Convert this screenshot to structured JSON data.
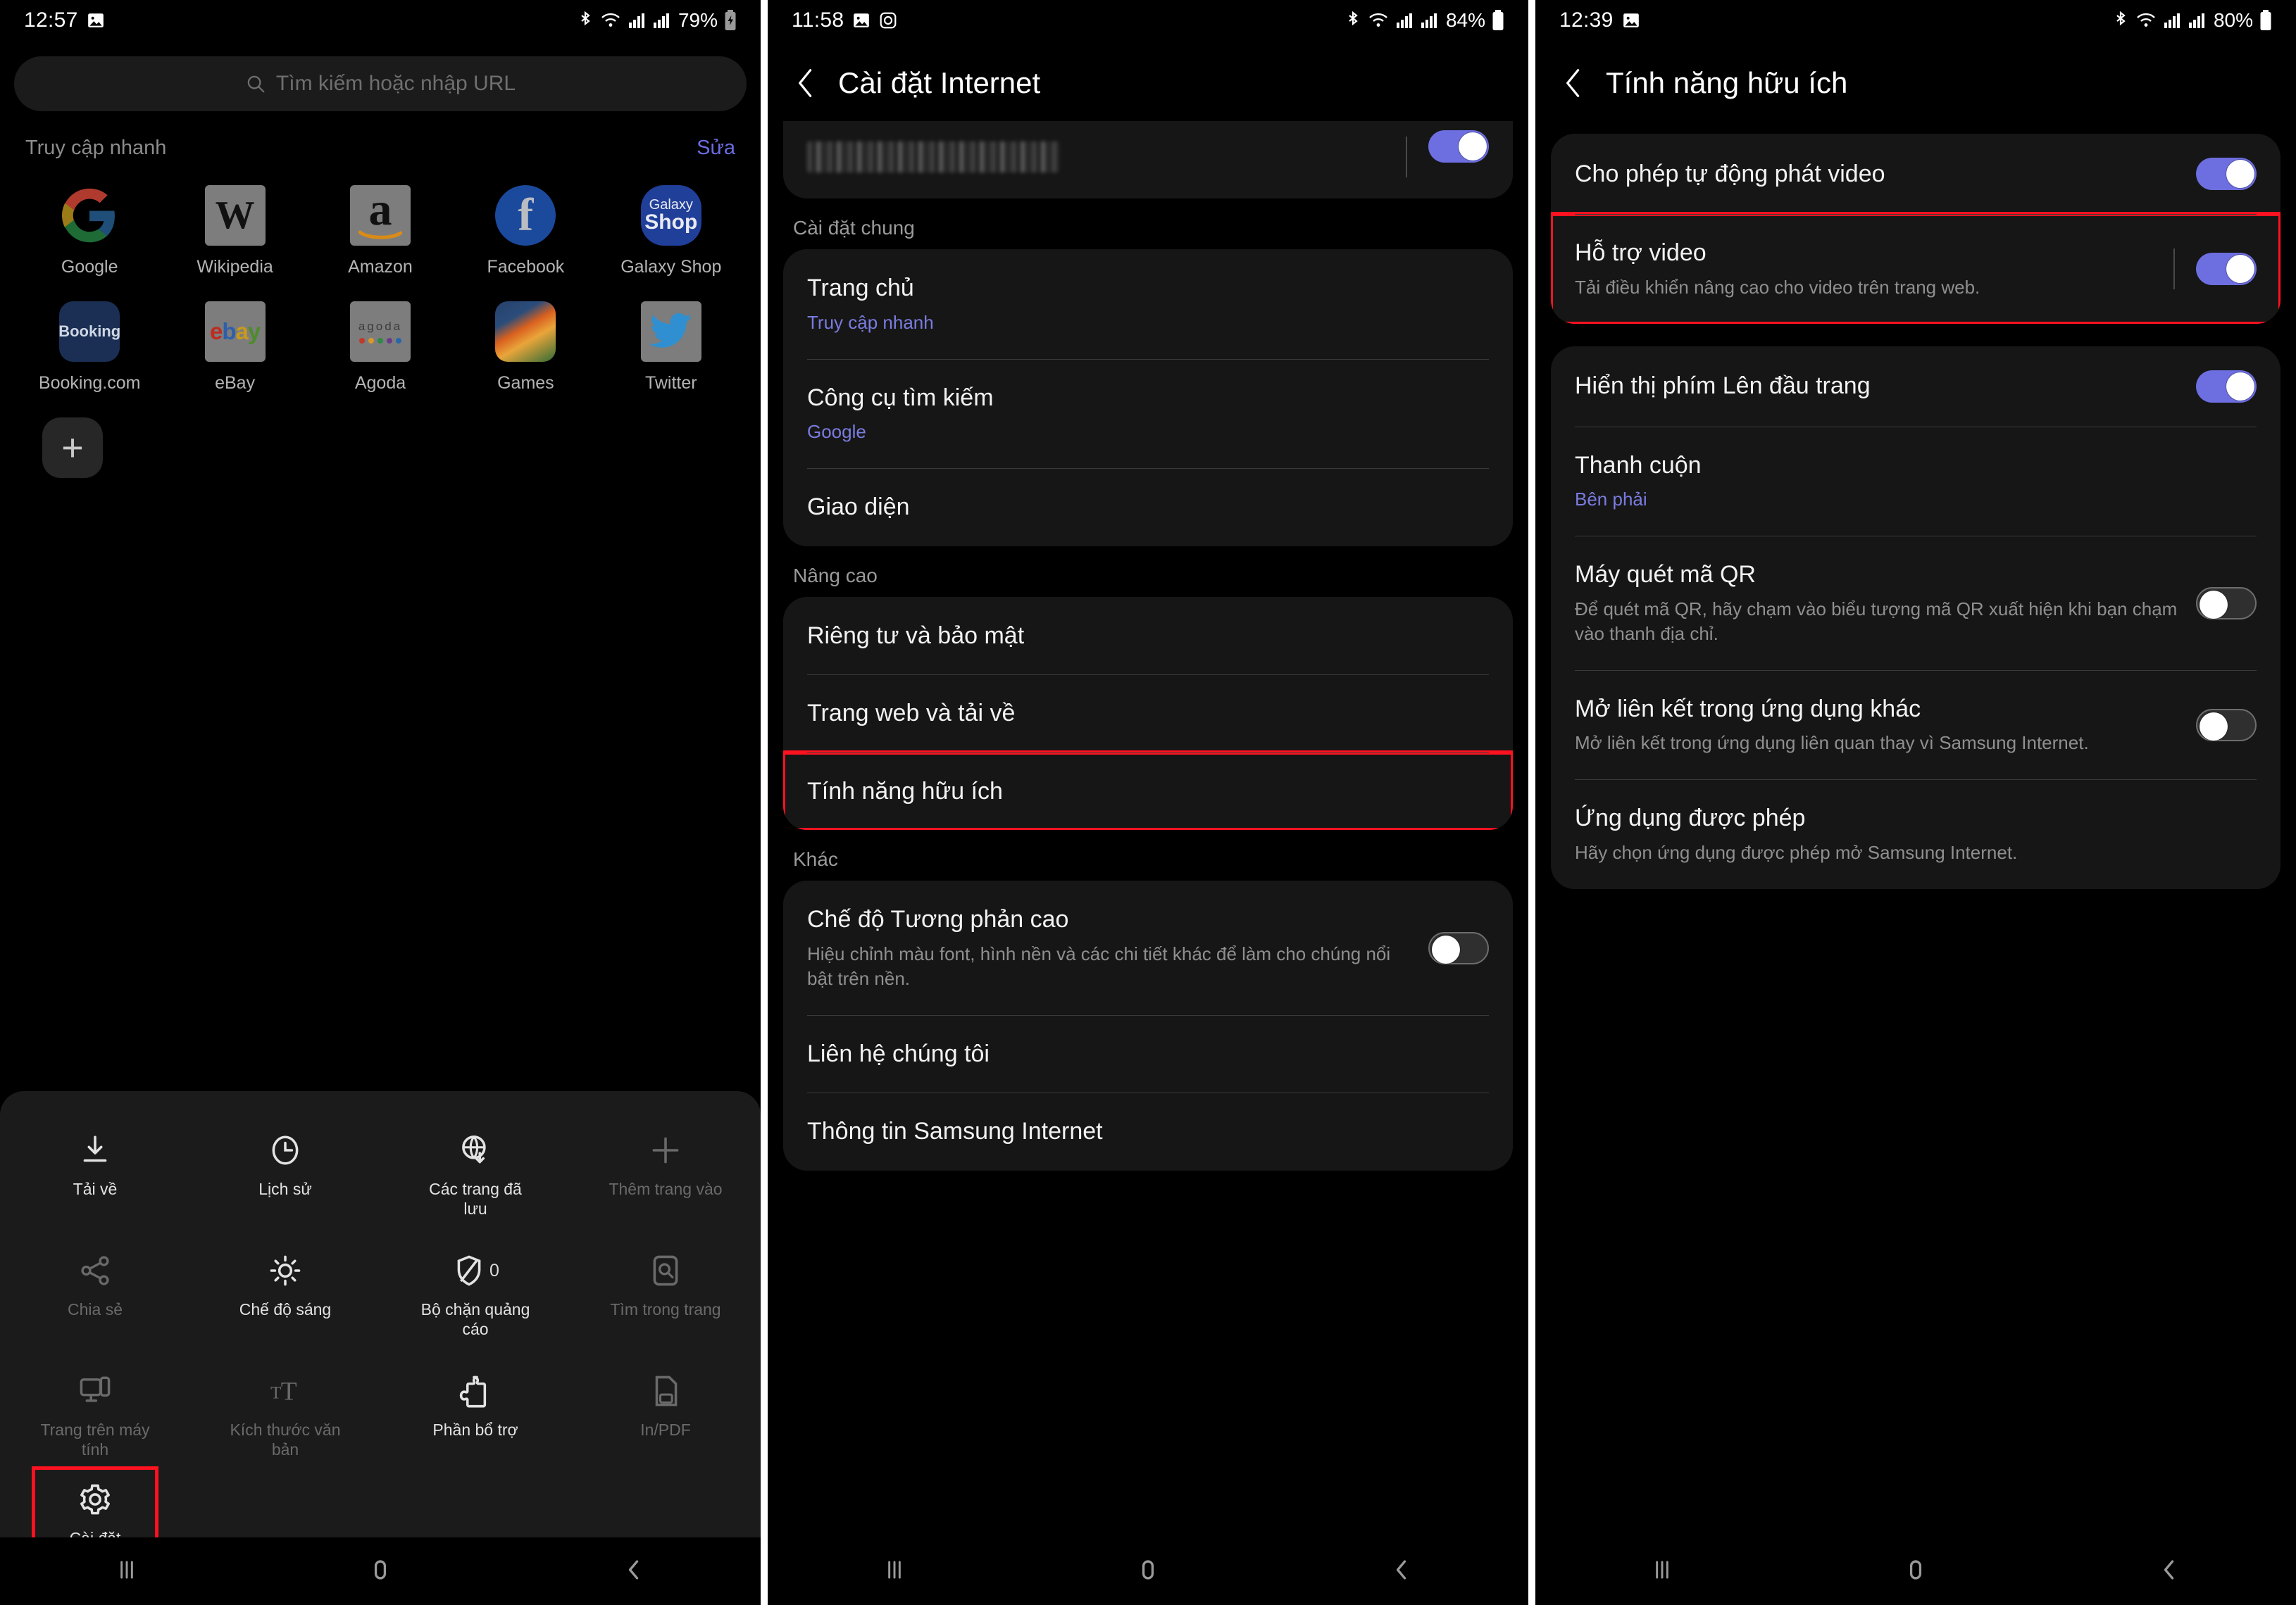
{
  "panel1": {
    "status": {
      "time": "12:57",
      "battery": "79%",
      "icons": [
        "image-icon",
        "bluetooth-icon",
        "wifi-icon",
        "signal-icon",
        "signal2-icon",
        "battery-charging-icon"
      ]
    },
    "urlbar": {
      "placeholder": "Tìm kiếm hoặc nhập URL",
      "icon": "search-icon"
    },
    "quick_access": {
      "title": "Truy cập nhanh",
      "edit_label": "Sửa",
      "items": [
        {
          "label": "Google",
          "icon": "google-icon"
        },
        {
          "label": "Wikipedia",
          "icon": "wikipedia-icon"
        },
        {
          "label": "Amazon",
          "icon": "amazon-icon"
        },
        {
          "label": "Facebook",
          "icon": "facebook-icon"
        },
        {
          "label": "Galaxy Shop",
          "icon": "galaxy-shop-icon"
        },
        {
          "label": "Booking.com",
          "icon": "booking-icon"
        },
        {
          "label": "eBay",
          "icon": "ebay-icon"
        },
        {
          "label": "Agoda",
          "icon": "agoda-icon"
        },
        {
          "label": "Games",
          "icon": "games-icon"
        },
        {
          "label": "Twitter",
          "icon": "twitter-icon"
        }
      ],
      "add_label": "+"
    },
    "menu": {
      "items": [
        {
          "label": "Tải về",
          "icon": "download-icon",
          "enabled": true
        },
        {
          "label": "Lịch sử",
          "icon": "history-clock-icon",
          "enabled": true
        },
        {
          "label": "Các trang đã lưu",
          "icon": "saved-pages-globe-icon",
          "enabled": true
        },
        {
          "label": "Thêm trang vào",
          "icon": "plus-icon",
          "enabled": false
        },
        {
          "label": "Chia sẻ",
          "icon": "share-icon",
          "enabled": false
        },
        {
          "label": "Chế độ sáng",
          "icon": "brightness-sun-icon",
          "enabled": true
        },
        {
          "label": "Bộ chặn quảng cáo",
          "icon": "ad-blocker-shield-icon",
          "enabled": true,
          "badge": "0"
        },
        {
          "label": "Tìm trong trang",
          "icon": "find-in-page-icon",
          "enabled": false
        },
        {
          "label": "Trang trên máy tính",
          "icon": "desktop-view-icon",
          "enabled": false
        },
        {
          "label": "Kích thước văn bản",
          "icon": "text-size-icon",
          "enabled": false
        },
        {
          "label": "Phần bổ trợ",
          "icon": "add-ons-puzzle-icon",
          "enabled": true
        },
        {
          "label": "In/PDF",
          "icon": "print-pdf-icon",
          "enabled": false
        },
        {
          "label": "Cài đặt",
          "icon": "gear-icon",
          "enabled": true,
          "highlighted": true
        }
      ]
    },
    "navbar": {
      "recents": "recents-icon",
      "home": "home-icon",
      "back": "back-icon"
    }
  },
  "panel2": {
    "status": {
      "time": "11:58",
      "battery": "84%"
    },
    "appbar": {
      "title": "Cài đặt Internet",
      "back_icon": "back-chevron-icon"
    },
    "redacted_row": {
      "label": "",
      "toggle": "on"
    },
    "sections": [
      {
        "title": "Cài đặt chung",
        "rows": [
          {
            "title": "Trang chủ",
            "sub": "Truy cập nhanh",
            "sub_accent": true
          },
          {
            "title": "Công cụ tìm kiếm",
            "sub": "Google",
            "sub_accent": true
          },
          {
            "title": "Giao diện",
            "sub": ""
          }
        ]
      },
      {
        "title": "Nâng cao",
        "rows": [
          {
            "title": "Riêng tư và bảo mật",
            "sub": ""
          },
          {
            "title": "Trang web và tải về",
            "sub": ""
          },
          {
            "title": "Tính năng hữu ích",
            "sub": "",
            "highlighted": true
          }
        ]
      },
      {
        "title": "Khác",
        "rows": [
          {
            "title": "Chế độ Tương phản cao",
            "sub": "Hiệu chỉnh màu font, hình nền và các chi tiết khác để làm cho chúng nổi bật trên nền.",
            "toggle": "off"
          },
          {
            "title": "Liên hệ chúng tôi",
            "sub": ""
          },
          {
            "title": "Thông tin Samsung Internet",
            "sub": ""
          }
        ]
      }
    ],
    "navbar": {
      "recents": "recents-icon",
      "home": "home-icon",
      "back": "back-icon"
    }
  },
  "panel3": {
    "status": {
      "time": "12:39",
      "battery": "80%"
    },
    "appbar": {
      "title": "Tính năng hữu ích",
      "back_icon": "back-chevron-icon"
    },
    "group1": [
      {
        "title": "Cho phép tự động phát video",
        "sub": "",
        "toggle": "on"
      },
      {
        "title": "Hỗ trợ video",
        "sub": "Tải điều khiển nâng cao cho video trên trang web.",
        "toggle": "on",
        "highlighted": true
      }
    ],
    "group2": [
      {
        "title": "Hiển thị phím Lên đầu trang",
        "sub": "",
        "toggle": "on"
      },
      {
        "title": "Thanh cuộn",
        "sub": "Bên phải",
        "sub_accent": true
      },
      {
        "title": "Máy quét mã QR",
        "sub": "Để quét mã QR, hãy chạm vào biểu tượng mã QR xuất hiện khi bạn chạm vào thanh địa chỉ.",
        "toggle": "off"
      },
      {
        "title": "Mở liên kết trong ứng dụng khác",
        "sub": "Mở liên kết trong ứng dụng liên quan thay vì Samsung Internet.",
        "toggle": "off"
      },
      {
        "title": "Ứng dụng được phép",
        "sub": "Hãy chọn ứng dụng được phép mở Samsung Internet."
      }
    ],
    "navbar": {
      "recents": "recents-icon",
      "home": "home-icon",
      "back": "back-icon"
    }
  },
  "colors": {
    "accent": "#6d6ee0",
    "highlight": "#ff1220",
    "card": "#161616",
    "background": "#000000"
  }
}
